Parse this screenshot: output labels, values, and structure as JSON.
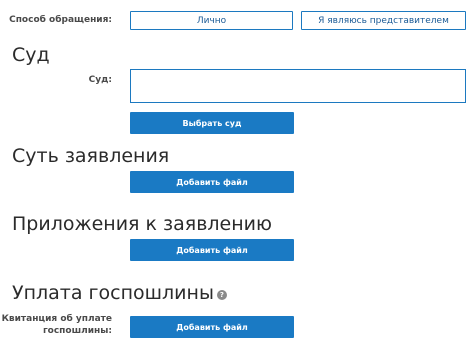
{
  "appeal_method": {
    "label": "Способ обращения:",
    "option_personal": "Лично",
    "option_representative": "Я являюсь представителем"
  },
  "court_section": {
    "title": "Суд",
    "field_label": "Суд:",
    "field_value": "",
    "select_button": "Выбрать суд"
  },
  "statement_section": {
    "title": "Суть заявления",
    "add_file_button": "Добавить файл"
  },
  "attachments_section": {
    "title": "Приложения к заявлению",
    "add_file_button": "Добавить файл"
  },
  "fee_section": {
    "title": "Уплата госпошлины",
    "help_icon": "question-circle-icon",
    "receipt_label_line1": "Квитанция об уплате",
    "receipt_label_line2": "госпошлины:",
    "add_file_button": "Добавить файл"
  },
  "colors": {
    "accent": "#1a7ac4",
    "border": "#1c79c0"
  }
}
